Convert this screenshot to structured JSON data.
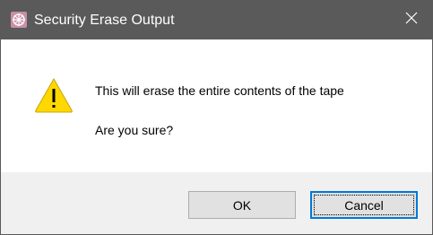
{
  "window": {
    "title": "Security Erase Output",
    "app_icon": "app-logo-icon",
    "close_icon": "close-icon"
  },
  "message": {
    "icon": "warning-icon",
    "line1": "This will erase the entire contents of the tape",
    "line2": "Are you sure?"
  },
  "buttons": {
    "ok_label": "OK",
    "cancel_label": "Cancel",
    "default": "Cancel"
  },
  "colors": {
    "titlebar": "#5a5a5a",
    "footer": "#f0f0f0",
    "focus_border": "#0078d7",
    "warning_fill": "#ffd800"
  }
}
